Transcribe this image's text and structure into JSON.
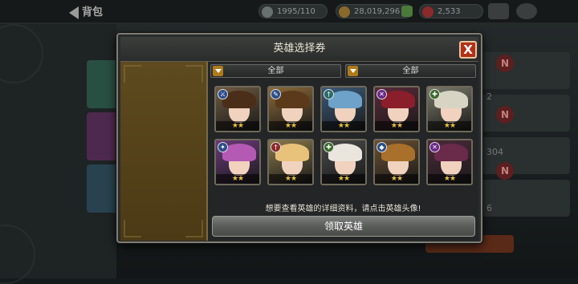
{
  "background": {
    "back_label": "背包",
    "stamina": "1995/110",
    "gold": "28,019,296",
    "gems": "2,533",
    "right_counts": [
      "2",
      "304",
      "6"
    ],
    "badge": "N"
  },
  "dialog": {
    "title": "英雄选择券",
    "close_label": "X",
    "filters": [
      "全部",
      "全部"
    ],
    "hint": "想要查看英雄的详细资料，请点击英雄头像!",
    "claim_label": "领取英雄"
  },
  "heroes": [
    {
      "class_icon": "sword-icon",
      "stars": "★★",
      "hair": "#4a2e1a",
      "bg": "#6e5a40",
      "badge": "#2c4e8a"
    },
    {
      "class_icon": "wrench-icon",
      "stars": "★★",
      "hair": "#5a3a1a",
      "bg": "#8c6a3a",
      "badge": "#2c4e8a"
    },
    {
      "class_icon": "staff-icon",
      "stars": "★★",
      "hair": "#6ea2c8",
      "bg": "#3c5a7a",
      "badge": "#2c6a6a"
    },
    {
      "class_icon": "crossed-swords-icon",
      "stars": "★★",
      "hair": "#8a1e2a",
      "bg": "#5a2a3a",
      "badge": "#6a2a8a"
    },
    {
      "class_icon": "cross-icon",
      "stars": "★★",
      "hair": "#d8d4c4",
      "bg": "#7a7a6a",
      "badge": "#3a6a2a"
    },
    {
      "class_icon": "wand-icon",
      "stars": "★★",
      "hair": "#b45ab4",
      "bg": "#6a3a7a",
      "badge": "#2c4e8a"
    },
    {
      "class_icon": "staff-icon",
      "stars": "★★",
      "hair": "#e8c27a",
      "bg": "#8a7a4a",
      "badge": "#8a2a2a"
    },
    {
      "class_icon": "cross-icon",
      "stars": "★★",
      "hair": "#eae6de",
      "bg": "#4a4a4a",
      "badge": "#3a6a2a"
    },
    {
      "class_icon": "shield-icon",
      "stars": "★★",
      "hair": "#a8702a",
      "bg": "#6a5032",
      "badge": "#2c4e8a"
    },
    {
      "class_icon": "crossed-swords-icon",
      "stars": "★★",
      "hair": "#6a2a4a",
      "bg": "#4a2a3a",
      "badge": "#6a2a8a"
    }
  ]
}
